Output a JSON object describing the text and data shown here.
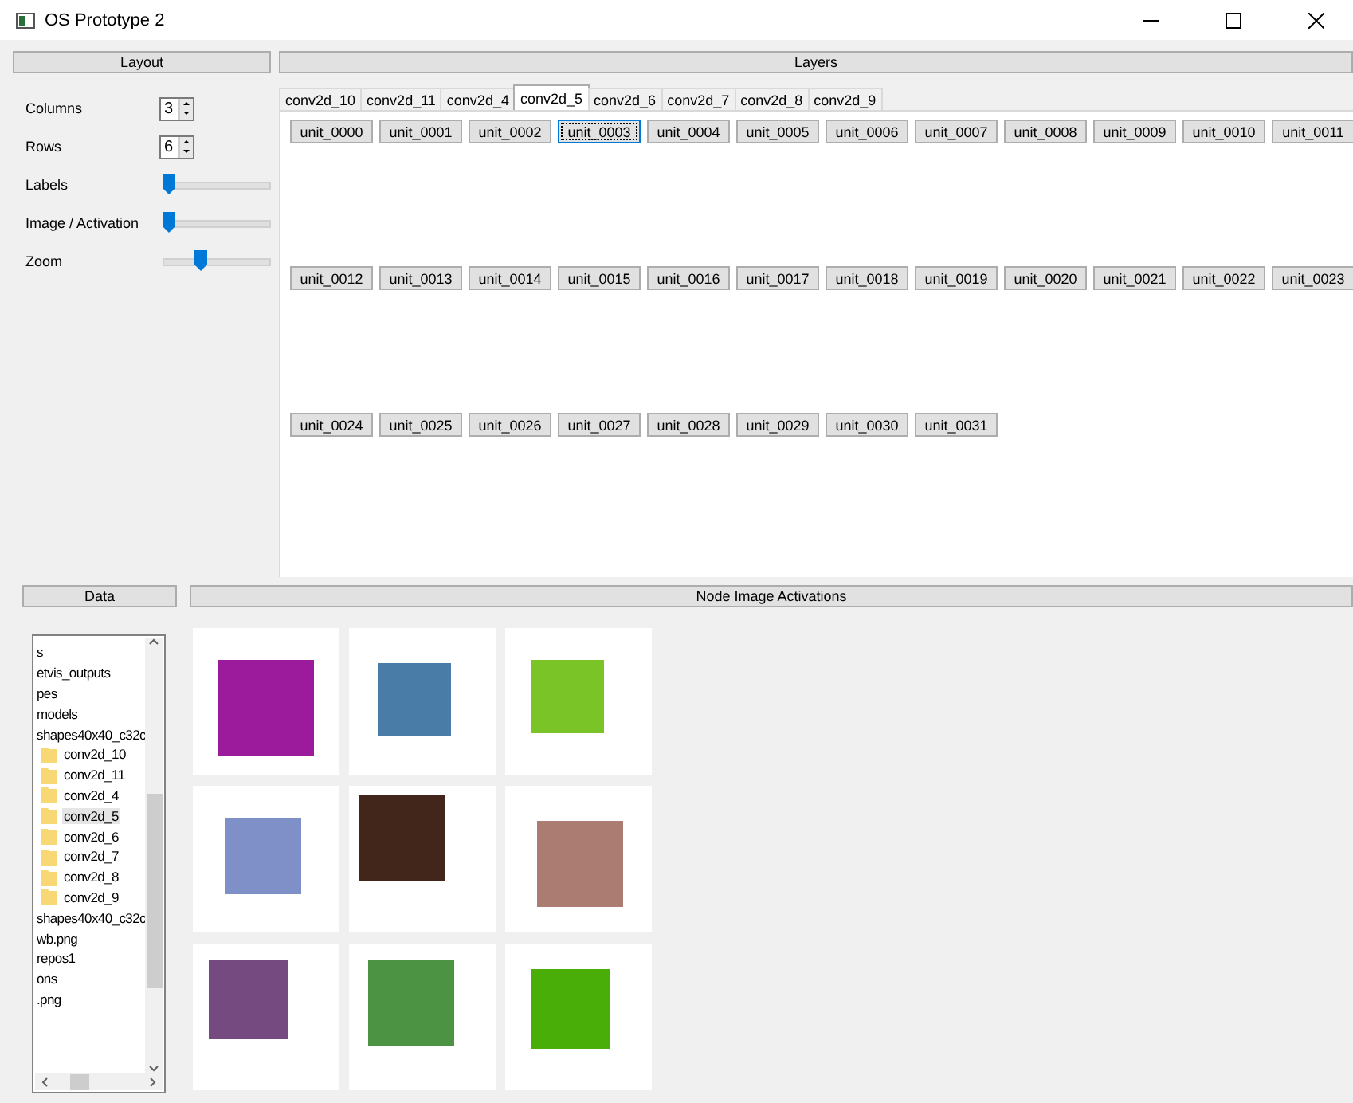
{
  "window": {
    "title": "OS Prototype 2"
  },
  "layout": {
    "title": "Layout",
    "spinners": [
      {
        "label": "Columns",
        "value": "3"
      },
      {
        "label": "Rows",
        "value": "6"
      }
    ],
    "sliders": [
      {
        "label": "Labels",
        "level": 0.05
      },
      {
        "label": "Image / Activation",
        "level": 0.05
      },
      {
        "label": "Zoom",
        "level": 0.35
      }
    ]
  },
  "layers": {
    "title": "Layers",
    "tabs": [
      {
        "label": "conv2d_10",
        "selected": false
      },
      {
        "label": "conv2d_11",
        "selected": false
      },
      {
        "label": "conv2d_4",
        "selected": false
      },
      {
        "label": "conv2d_5",
        "selected": true
      },
      {
        "label": "conv2d_6",
        "selected": false
      },
      {
        "label": "conv2d_7",
        "selected": false
      },
      {
        "label": "conv2d_8",
        "selected": false
      },
      {
        "label": "conv2d_9",
        "selected": false
      }
    ],
    "units": [
      {
        "label": "unit_0000",
        "focused": false
      },
      {
        "label": "unit_0001",
        "focused": false
      },
      {
        "label": "unit_0002",
        "focused": false
      },
      {
        "label": "unit_0003",
        "focused": true
      },
      {
        "label": "unit_0004",
        "focused": false
      },
      {
        "label": "unit_0005",
        "focused": false
      },
      {
        "label": "unit_0006",
        "focused": false
      },
      {
        "label": "unit_0007",
        "focused": false
      },
      {
        "label": "unit_0008",
        "focused": false
      },
      {
        "label": "unit_0009",
        "focused": false
      },
      {
        "label": "unit_0010",
        "focused": false
      },
      {
        "label": "unit_0011",
        "focused": false
      },
      {
        "label": "unit_0012",
        "focused": false
      },
      {
        "label": "unit_0013",
        "focused": false
      },
      {
        "label": "unit_0014",
        "focused": false
      },
      {
        "label": "unit_0015",
        "focused": false
      },
      {
        "label": "unit_0016",
        "focused": false
      },
      {
        "label": "unit_0017",
        "focused": false
      },
      {
        "label": "unit_0018",
        "focused": false
      },
      {
        "label": "unit_0019",
        "focused": false
      },
      {
        "label": "unit_0020",
        "focused": false
      },
      {
        "label": "unit_0021",
        "focused": false
      },
      {
        "label": "unit_0022",
        "focused": false
      },
      {
        "label": "unit_0023",
        "focused": false
      },
      {
        "label": "unit_0024",
        "focused": false
      },
      {
        "label": "unit_0025",
        "focused": false
      },
      {
        "label": "unit_0026",
        "focused": false
      },
      {
        "label": "unit_0027",
        "focused": false
      },
      {
        "label": "unit_0028",
        "focused": false
      },
      {
        "label": "unit_0029",
        "focused": false
      },
      {
        "label": "unit_0030",
        "focused": false
      },
      {
        "label": "unit_0031",
        "focused": false
      }
    ]
  },
  "data": {
    "title": "Data",
    "tree": [
      {
        "label": "s"
      },
      {
        "label": "etvis_outputs"
      },
      {
        "label": "pes"
      },
      {
        "label": "models"
      },
      {
        "label": "shapes40x40_c32c",
        "children": [
          {
            "label": "conv2d_10",
            "selected": false
          },
          {
            "label": "conv2d_11",
            "selected": false
          },
          {
            "label": "conv2d_4",
            "selected": false
          },
          {
            "label": "conv2d_5",
            "selected": true
          },
          {
            "label": "conv2d_6",
            "selected": false
          },
          {
            "label": "conv2d_7",
            "selected": false
          },
          {
            "label": "conv2d_8",
            "selected": false
          },
          {
            "label": "conv2d_9",
            "selected": false
          }
        ]
      },
      {
        "label": "shapes40x40_c32c"
      },
      {
        "label": "wb.png"
      },
      {
        "label": "repos1"
      },
      {
        "label": "ons"
      },
      {
        "label": ".png"
      }
    ]
  },
  "activations": {
    "title": "Node Image Activations",
    "images": [
      {
        "color": "#9c1a9c"
      },
      {
        "color": "#4a7ca8"
      },
      {
        "color": "#7ac428"
      },
      {
        "color": "#7f8fc8"
      },
      {
        "color": "#42261c"
      },
      {
        "color": "#ab7c72"
      },
      {
        "color": "#744a80"
      },
      {
        "color": "#4c9444"
      },
      {
        "color": "#4aae08"
      }
    ]
  }
}
